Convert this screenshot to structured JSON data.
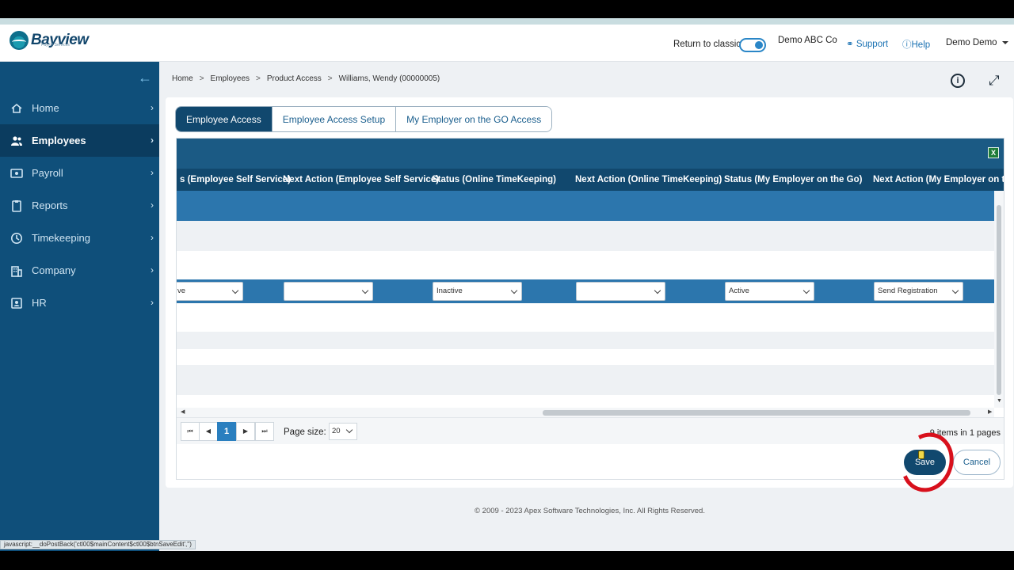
{
  "header": {
    "brand": "Bayview",
    "brand_sub": "Payroll Services",
    "return_classic": "Return to classic",
    "company": "Demo ABC Co",
    "support": "Support",
    "help": "Help",
    "user": "Demo Demo"
  },
  "sidebar": {
    "items": [
      {
        "label": "Home",
        "icon": "home-icon"
      },
      {
        "label": "Employees",
        "icon": "people-icon"
      },
      {
        "label": "Payroll",
        "icon": "payroll-icon"
      },
      {
        "label": "Reports",
        "icon": "clipboard-icon"
      },
      {
        "label": "Timekeeping",
        "icon": "clock-icon"
      },
      {
        "label": "Company",
        "icon": "building-icon"
      },
      {
        "label": "HR",
        "icon": "id-card-icon"
      }
    ],
    "active": "Employees"
  },
  "breadcrumb": [
    "Home",
    "Employees",
    "Product Access",
    "Williams, Wendy (00000005)"
  ],
  "tabs": [
    {
      "label": "Employee Access",
      "active": true
    },
    {
      "label": "Employee Access Setup",
      "active": false
    },
    {
      "label": "My Employer on the GO Access",
      "active": false
    }
  ],
  "grid": {
    "columns": [
      "s (Employee Self Service)",
      "Next Action (Employee Self Service)",
      "Status (Online TimeKeeping)",
      "Next Action (Online TimeKeeping)",
      "Status (My Employer on the Go)",
      "Next Action (My Employer on t"
    ],
    "selects": [
      "ve",
      "",
      "Inactive",
      "",
      "Active",
      "Send Registration"
    ],
    "excel_icon": "excel-export-icon"
  },
  "pager": {
    "current_page": "1",
    "page_size_label": "Page size:",
    "page_size": "20",
    "info": "9 items in 1 pages"
  },
  "actions": {
    "save": "Save",
    "cancel": "Cancel"
  },
  "footer": "© 2009 - 2023 Apex Software Technologies, Inc. All Rights Reserved.",
  "status_bar": "javascript:__doPostBack('ctl00$mainContent$ctl00$btnSaveEdit','')"
}
